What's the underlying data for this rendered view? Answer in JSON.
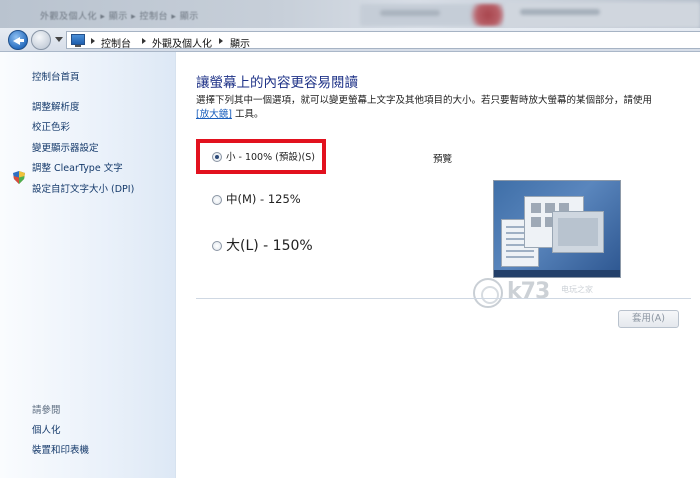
{
  "titlebar": {
    "blurred_text": "外觀及個人化 ▸ 顯示 ▸ 控制台 ▸ 顯示"
  },
  "address": {
    "crumbs": [
      "控制台",
      "外觀及個人化",
      "顯示"
    ]
  },
  "sidebar": {
    "home": "控制台首頁",
    "items": [
      {
        "label": "調整解析度"
      },
      {
        "label": "校正色彩",
        "icon": "shield-icon"
      },
      {
        "label": "變更顯示器設定"
      },
      {
        "label": "調整 ClearType 文字"
      },
      {
        "label": "設定自訂文字大小 (DPI)"
      }
    ],
    "see_also_title": "請參閱",
    "see_also": [
      "個人化",
      "裝置和印表機"
    ]
  },
  "main": {
    "heading": "讓螢幕上的內容更容易閱讀",
    "desc_line1": "選擇下列其中一個選項，就可以變更螢幕上文字及其他項目的大小。若只要暫時放大螢幕的某個部分，請使用",
    "desc_link": "[放大鏡]",
    "desc_line2_tail": " 工具。",
    "options": [
      {
        "label": "小 - 100% (預設)(S)",
        "checked": true
      },
      {
        "label": "中(M) - 125%",
        "checked": false
      },
      {
        "label": "大(L) - 150%",
        "checked": false
      }
    ],
    "preview_label": "預覽",
    "apply_label": "套用(A)"
  },
  "watermark": {
    "text": "k73",
    "sub": "电玩之家"
  },
  "colors": {
    "heading": "#1e3287",
    "link": "#153a6b",
    "highlight": "#e2111e"
  }
}
